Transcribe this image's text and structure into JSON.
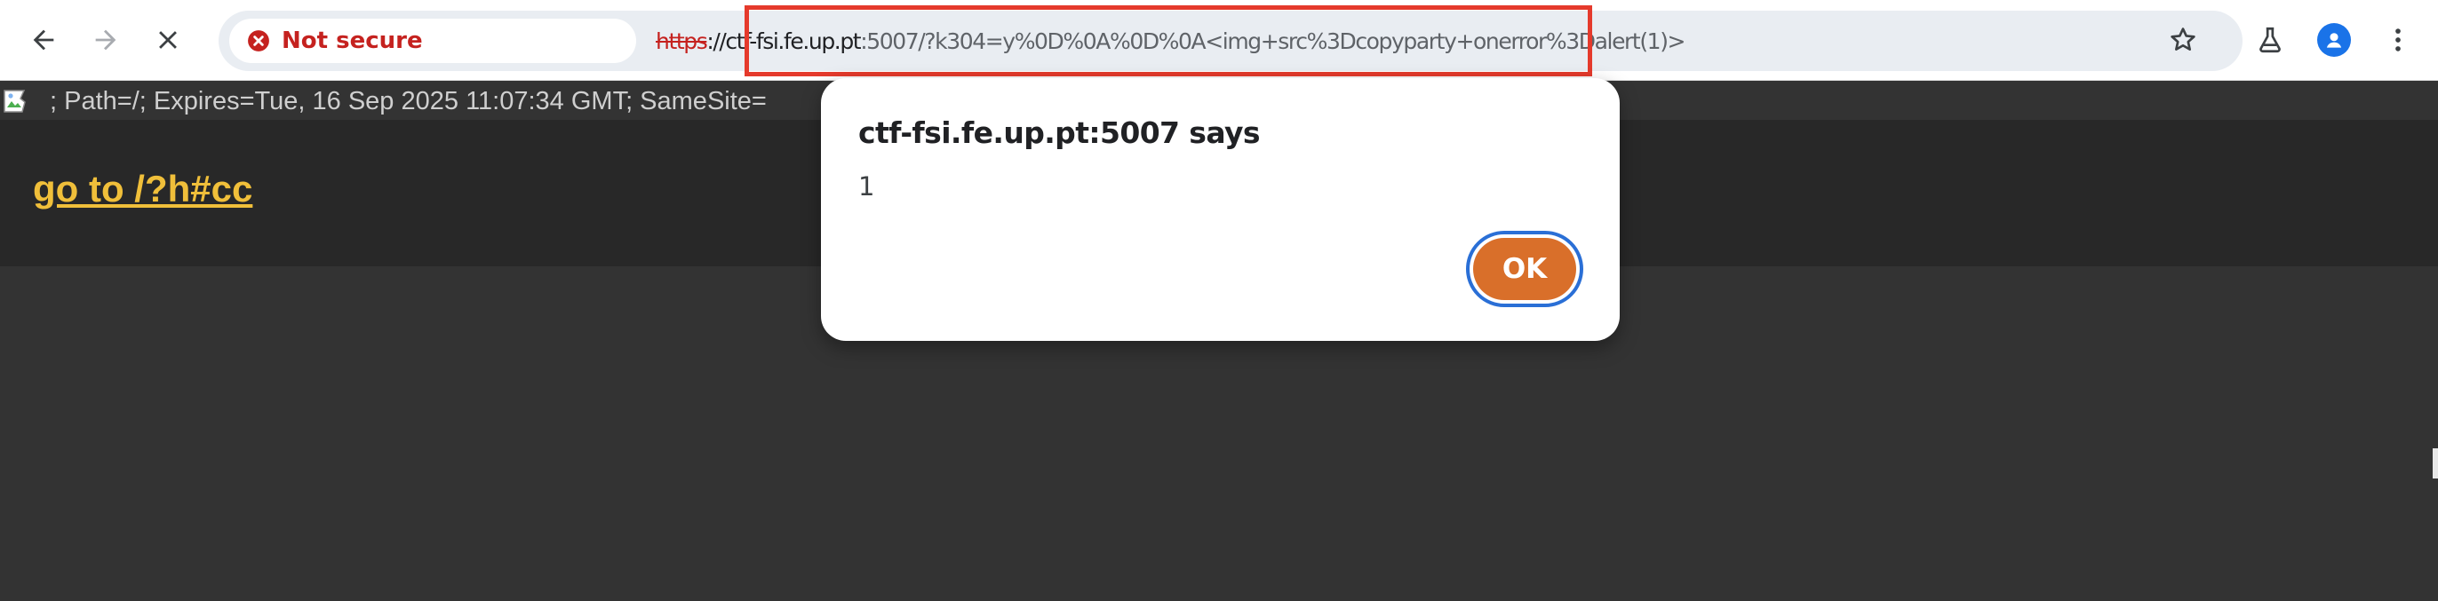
{
  "browser": {
    "security_chip": "Not secure",
    "url": {
      "scheme": "https",
      "separator": "://",
      "host": "ctf-fsi.fe.up.pt",
      "port": ":5007",
      "path_query": "/?k304=y%0D%0A%0D%0A<img+src%3Dcopyparty+onerror%3Dalert(1)>"
    },
    "icons": {
      "back": "back-arrow-icon",
      "forward": "forward-arrow-icon",
      "stop": "close-icon",
      "security": "error-circle-icon",
      "bookmark": "star-icon",
      "labs": "flask-icon",
      "profile": "person-avatar-icon",
      "menu": "kebab-menu-icon"
    },
    "colors": {
      "warning_red": "#c5221f",
      "highlight_box": "#e53a2c",
      "profile_blue": "#1a73e8"
    }
  },
  "page": {
    "cookie_line": "; Path=/; Expires=Tue, 16 Sep 2025 11:07:34 GMT; SameSite=",
    "link_text": "go to /?h#cc",
    "colors": {
      "background": "#333333",
      "header_band": "#282828",
      "link": "#f0bf3a"
    }
  },
  "dialog": {
    "title": "ctf-fsi.fe.up.pt:5007 says",
    "message": "1",
    "ok_label": "OK",
    "colors": {
      "ok_button": "#d96f2a",
      "focus_ring": "#2a6fd6"
    }
  }
}
